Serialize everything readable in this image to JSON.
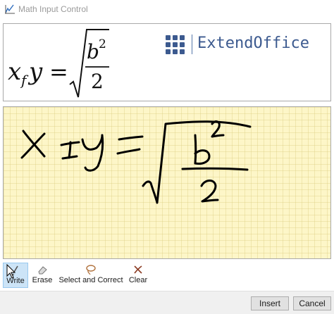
{
  "window": {
    "title": "Math Input Control",
    "title_color": "#9a9a9a"
  },
  "preview": {
    "brand_text": "ExtendOffice",
    "brand_color": "#3c5a8f",
    "formula": {
      "lhs_base": "x",
      "lhs_subscript": "f",
      "lhs_var": "y",
      "equals": "=",
      "numerator_base": "b",
      "numerator_exponent": "2",
      "denominator": "2"
    }
  },
  "inkpad": {
    "background": "#fdf6c8",
    "ink_color": "#000000"
  },
  "tools": [
    {
      "label": "Write",
      "icon": "pen-icon",
      "active": true
    },
    {
      "label": "Erase",
      "icon": "eraser-icon",
      "active": false
    },
    {
      "label": "Select and Correct",
      "icon": "lasso-icon",
      "active": false
    },
    {
      "label": "Clear",
      "icon": "clear-icon",
      "active": false
    }
  ],
  "buttons": {
    "insert_label": "Insert",
    "cancel_label": "Cancel"
  }
}
